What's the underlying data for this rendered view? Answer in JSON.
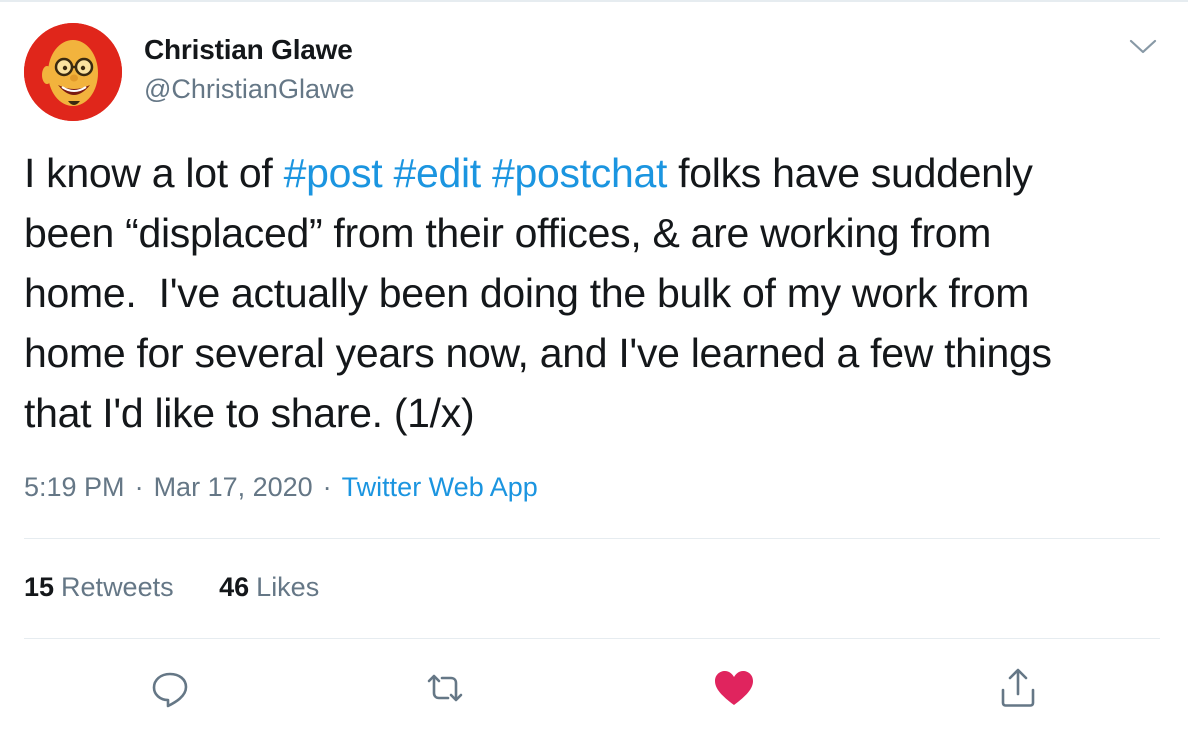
{
  "author": {
    "name": "Christian Glawe",
    "handle": "@ChristianGlawe",
    "avatar_icon": "cartoon-portrait-avatar"
  },
  "tweet": {
    "lines": [
      [
        {
          "text": "I know a lot of ",
          "type": "text"
        },
        {
          "text": "#post",
          "type": "hashtag"
        },
        {
          "text": " ",
          "type": "text"
        },
        {
          "text": "#edit",
          "type": "hashtag"
        },
        {
          "text": " ",
          "type": "text"
        },
        {
          "text": "#postchat",
          "type": "hashtag"
        },
        {
          "text": " folks have suddenly",
          "type": "text"
        }
      ],
      [
        {
          "text": "been “displaced” from their offices, & are working from",
          "type": "text"
        }
      ],
      [
        {
          "text": "home.  I've actually been doing the bulk of my work from",
          "type": "text"
        }
      ],
      [
        {
          "text": "home for several years now, and I've learned a few things",
          "type": "text"
        }
      ],
      [
        {
          "text": "that I'd like to share. (1/x)",
          "type": "text"
        }
      ]
    ]
  },
  "meta": {
    "time": "5:19 PM",
    "date": "Mar 17, 2020",
    "separator": "·",
    "source": "Twitter Web App"
  },
  "stats": {
    "retweets_count": "15",
    "retweets_label": "Retweets",
    "likes_count": "46",
    "likes_label": "Likes"
  },
  "actions": {
    "reply_icon": "reply-icon",
    "retweet_icon": "retweet-icon",
    "like_icon": "heart-icon",
    "share_icon": "share-icon",
    "liked": true
  },
  "colors": {
    "text": "#14171a",
    "secondary": "#657786",
    "link": "#1b95e0",
    "like": "#e0245e",
    "divider": "#e6ecf0"
  }
}
